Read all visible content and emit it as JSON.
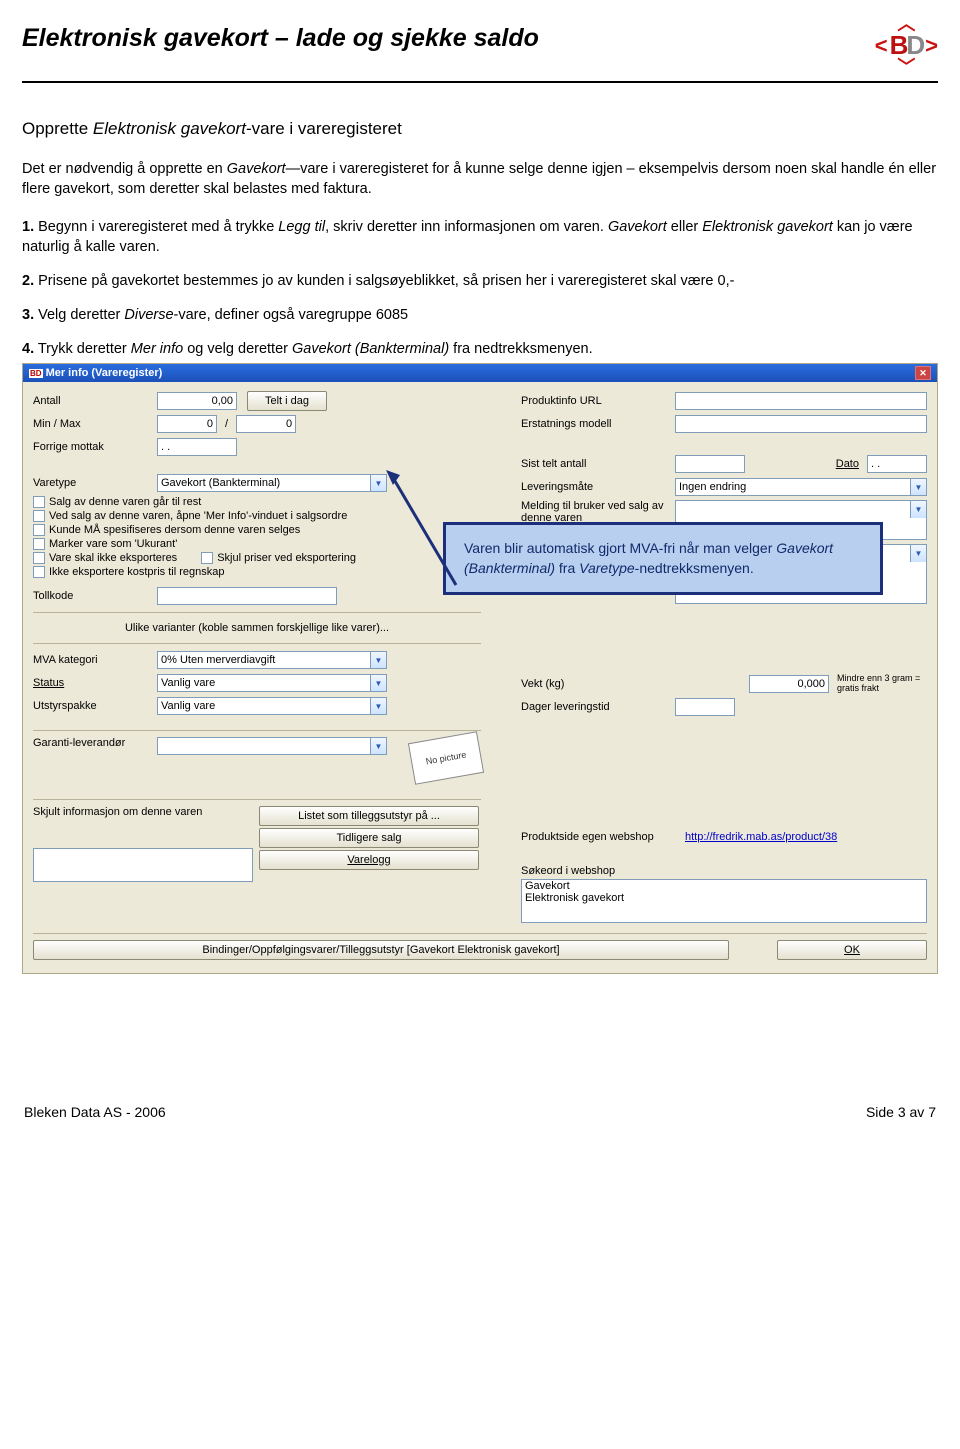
{
  "doc": {
    "title": "Elektronisk gavekort – lade og sjekke saldo",
    "section_heading_prefix": "Opprette ",
    "section_heading_italic": "Elektronisk gavekort",
    "section_heading_suffix": "-vare i vareregisteret",
    "intro_p1a": "Det er nødvendig å opprette en ",
    "intro_italic1": "Gavekort",
    "intro_p1b": "—vare i vareregisteret for å kunne selge denne igjen – eksempelvis dersom noen skal handle én eller flere gavekort, som deretter skal belastes med faktura.",
    "p1_num": "1.",
    "p1a": " Begynn i vareregisteret med å trykke ",
    "p1_italic1": "Legg til",
    "p1b": ", skriv deretter inn informasjonen om varen. ",
    "p1_italic2": "Gavekort",
    "p1c": " eller ",
    "p1_italic3": "Elektronisk gavekort",
    "p1d": " kan jo være naturlig å kalle varen.",
    "p2_num": "2.",
    "p2a": " Prisene på gavekortet bestemmes jo av kunden i salgsøyeblikket, så prisen her i vareregisteret skal være 0,-",
    "p3_num": "3.",
    "p3a": " Velg deretter ",
    "p3_italic1": "Diverse",
    "p3b": "-vare, definer også varegruppe 6085",
    "p4_num": "4.",
    "p4a": " Trykk deretter ",
    "p4_italic1": "Mer info",
    "p4b": " og velg deretter ",
    "p4_italic2": "Gavekort (Bankterminal)",
    "p4c": " fra nedtrekksmenyen.",
    "footer_left": "Bleken Data AS - 2006",
    "footer_right": "Side 3 av 7"
  },
  "callout": {
    "t1": "Varen blir automatisk gjort MVA-fri når man velger ",
    "italic1": "Gavekort (Bankterminal)",
    "t2": " fra ",
    "italic2": "Varetype",
    "t3": "-nedtrekksmenyen."
  },
  "win": {
    "title": "Mer info (Vareregister)",
    "left": {
      "antall_lab": "Antall",
      "antall_val": "0,00",
      "telt_btn": "Telt i dag",
      "minmax_lab": "Min / Max",
      "min_val": "0",
      "slash": "/",
      "max_val": "0",
      "forrige_lab": "Forrige mottak",
      "forrige_val": " .  .",
      "varetype_lab": "Varetype",
      "varetype_val": "Gavekort (Bankterminal)",
      "chk1": "Salg av denne varen går til rest",
      "chk2": "Ved salg av denne varen, åpne 'Mer Info'-vinduet i salgsordre",
      "chk3": "Kunde MÅ spesifiseres dersom denne varen selges",
      "chk4": "Marker vare som 'Ukurant'",
      "chk5": "Vare skal ikke eksporteres",
      "chk5b": "Skjul priser ved eksportering",
      "chk6": "Ikke eksportere kostpris til regnskap",
      "tollkode_lab": "Tollkode",
      "varianter_label": "Ulike varianter (koble sammen forskjellige like varer)...",
      "mva_lab": "MVA kategori",
      "mva_val": "0% Uten merverdiavgift",
      "status_lab": "Status",
      "status_val": "Vanlig vare",
      "utstyr_lab": "Utstyrspakke",
      "utstyr_val": "Vanlig vare",
      "garanti_lab": "Garanti-leverandør",
      "nopic": "No picture",
      "skjult_lab": "Skjult informasjon om denne varen",
      "listet_btn": "Listet som tilleggsutstyr på ...",
      "tidligere_btn": "Tidligere salg",
      "varelogg_btn": "Varelogg",
      "bindinger_btn": "Bindinger/Oppfølgingsvarer/Tilleggsutstyr [Gavekort  Elektronisk gavekort]"
    },
    "right": {
      "produktinfo_lab": "Produktinfo URL",
      "erstatning_lab": "Erstatnings modell",
      "sist_lab": "Sist telt antall",
      "dato_lab": "Dato",
      "dato_val": " .  .",
      "levering_lab": "Leveringsmåte",
      "levering_val": "Ingen endring",
      "melding_lab": "Melding til bruker ved salg av denne varen",
      "vekt_lab": "Vekt (kg)",
      "vekt_val": "0,000",
      "vekt_note": "Mindre enn 3 gram = gratis frakt",
      "dager_lab": "Dager leveringstid",
      "produktside_lab": "Produktside egen webshop",
      "produktside_link": "http://fredrik.mab.as/product/38",
      "sokeord_lab": "Søkeord i webshop",
      "sokeord_val": "Gavekort\nElektronisk gavekort",
      "ok_btn": "OK"
    }
  }
}
